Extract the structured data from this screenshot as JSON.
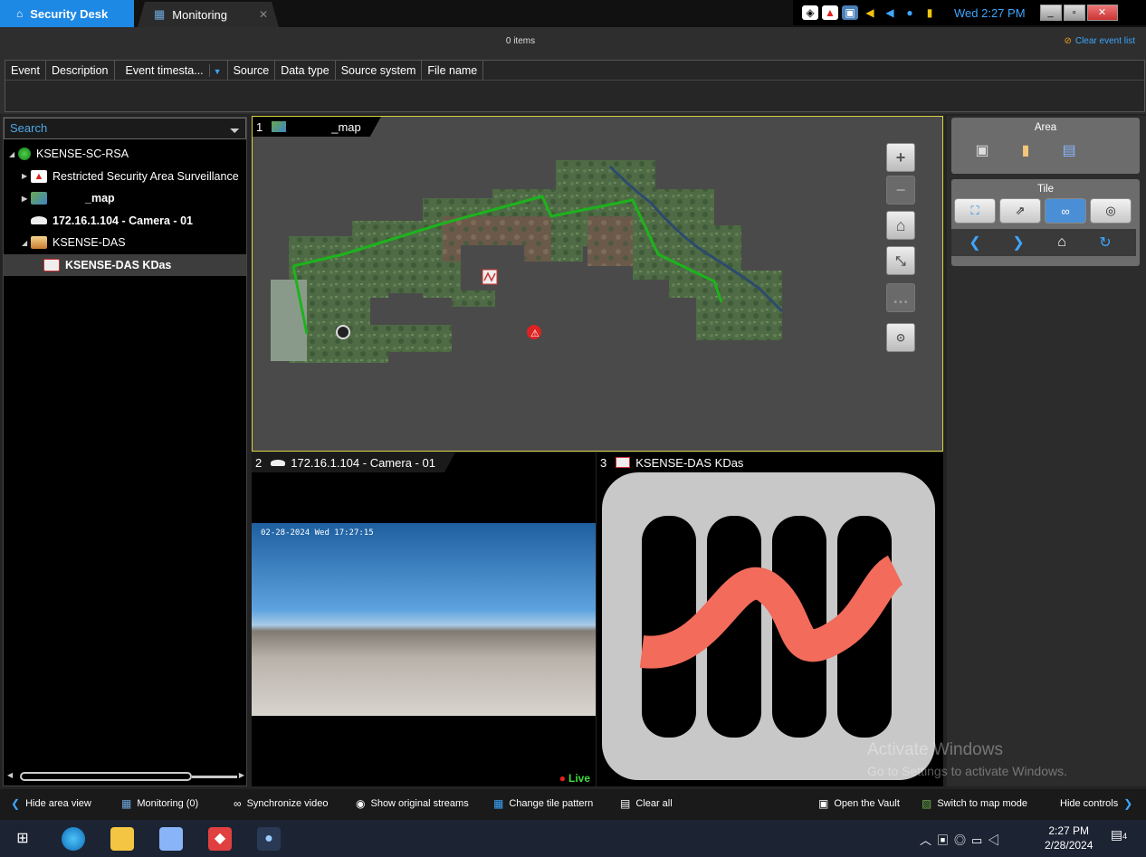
{
  "tabs": {
    "home_label": "Security Desk",
    "monitoring_label": "Monitoring",
    "close_glyph": "✕"
  },
  "tray": {
    "clock": "Wed 2:27 PM"
  },
  "event_list": {
    "count": "0 items",
    "clear_label": "Clear event list",
    "columns": [
      "Event",
      "Description",
      "Event timesta...",
      "Source",
      "Data type",
      "Source system",
      "File name"
    ]
  },
  "search": {
    "placeholder": "Search"
  },
  "tree": {
    "root": "KSENSE-SC-RSA",
    "items": [
      {
        "label": "Restricted Security Area Surveillance"
      },
      {
        "label": "_map"
      },
      {
        "label": "172.16.1.104 - Camera - 01"
      },
      {
        "label": "KSENSE-DAS"
      },
      {
        "label": "KSENSE-DAS KDas"
      }
    ]
  },
  "tiles": [
    {
      "num": "1",
      "title": "_map"
    },
    {
      "num": "2",
      "title": "172.16.1.104 - Camera - 01",
      "timestamp": "02-28-2024 Wed 17:27:15",
      "live": "Live"
    },
    {
      "num": "3",
      "title": "KSENSE-DAS KDas"
    }
  ],
  "map_controls": {
    "zoom_in": "+",
    "zoom_out": "−",
    "home": "⌂",
    "more": "…"
  },
  "right_panel": {
    "area_title": "Area",
    "tile_title": "Tile"
  },
  "bottom_toolbar": {
    "hide_area_view": "Hide area view",
    "monitoring": "Monitoring (0)",
    "synchronize_video": "Synchronize video",
    "show_original_streams": "Show original streams",
    "change_tile_pattern": "Change tile pattern",
    "clear_all": "Clear all",
    "open_vault": "Open the Vault",
    "switch_to_map": "Switch to map mode",
    "hide_controls": "Hide controls"
  },
  "watermark": {
    "line1": "Activate Windows",
    "line2": "Go to Settings to activate Windows."
  },
  "taskbar": {
    "time": "2:27 PM",
    "date": "2/28/2024",
    "notifications": "4"
  },
  "colors": {
    "accent": "#1e88e5",
    "selected_tile_border": "#d8d040",
    "live": "#3fd93f",
    "path_green": "#1db31d",
    "kdas_red": "#f26b5b"
  }
}
